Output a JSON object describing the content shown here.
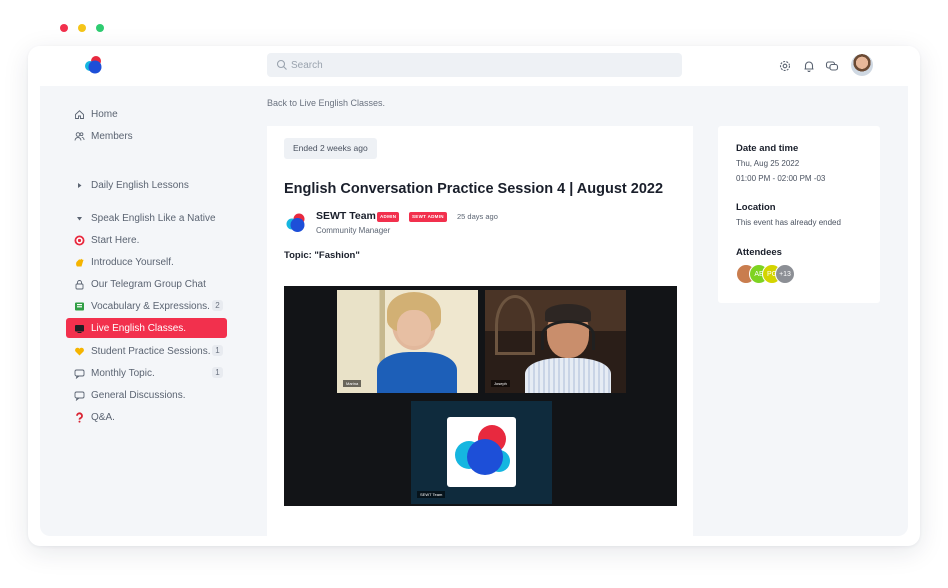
{
  "window_dots": [
    "#f2304d",
    "#f5c518",
    "#2ecc71"
  ],
  "colors": {
    "accent": "#f2304d",
    "brand_blue": "#1d4fd8",
    "brand_red": "#e8293f",
    "brand_cyan": "#15b6e0"
  },
  "header": {
    "search_placeholder": "Search",
    "icons": [
      "gear-icon",
      "bell-icon",
      "chat-icon"
    ]
  },
  "sidebar": {
    "items": [
      {
        "label": "Home",
        "icon": "home-icon"
      },
      {
        "label": "Members",
        "icon": "members-icon"
      },
      {
        "label": "Daily English Lessons",
        "icon": "triangle-right-icon"
      },
      {
        "label": "Speak English Like a Native",
        "icon": "triangle-down-icon"
      },
      {
        "label": "Start Here.",
        "icon": "target-icon"
      },
      {
        "label": "Introduce Yourself.",
        "icon": "wave-hand-icon"
      },
      {
        "label": "Our Telegram Group Chat",
        "icon": "lock-icon"
      },
      {
        "label": "Vocabulary & Expressions.",
        "icon": "book-icon",
        "badge": "2"
      },
      {
        "label": "Live English Classes.",
        "icon": "tv-icon",
        "active": true
      },
      {
        "label": "Student Practice Sessions.",
        "icon": "heart-icon",
        "badge": "1"
      },
      {
        "label": "Monthly Topic.",
        "icon": "message-icon",
        "badge": "1"
      },
      {
        "label": "General Discussions.",
        "icon": "message-icon"
      },
      {
        "label": "Q&A.",
        "icon": "question-icon"
      }
    ]
  },
  "breadcrumb": "Back to Live English Classes.",
  "event": {
    "status_chip": "Ended 2 weeks ago",
    "title": "English Conversation Practice Session 4 | August 2022",
    "author": {
      "name": "SEWT Team",
      "badges": [
        "ADMIN",
        "SEWT ADMIN"
      ],
      "posted": "25 days ago",
      "role": "Community Manager"
    },
    "topic": "Topic: \"Fashion\"",
    "video": {
      "participants": [
        "Marina",
        "Joseph",
        "SEWT Team"
      ]
    }
  },
  "details": {
    "date_heading": "Date and time",
    "date": "Thu, Aug 25 2022",
    "time": "01:00 PM - 02:00 PM -03",
    "location_heading": "Location",
    "location": "This event has already ended",
    "attendees_heading": "Attendees",
    "attendees": [
      {
        "initials": "",
        "color": "#c97d4e"
      },
      {
        "initials": "AE",
        "color": "#7ed321"
      },
      {
        "initials": "PG",
        "color": "#d4d400"
      },
      {
        "initials": "+13",
        "color": "#8c8f95"
      }
    ]
  }
}
